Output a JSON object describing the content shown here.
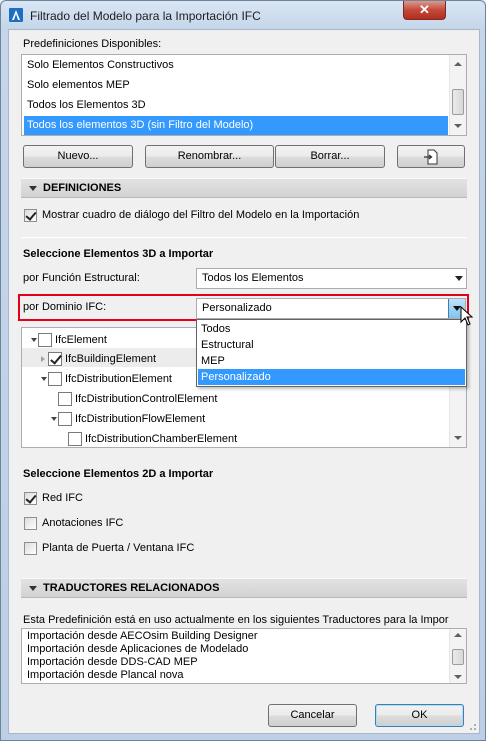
{
  "window": {
    "title": "Filtrado del Modelo para la Importación IFC",
    "close_label": "✕"
  },
  "presets": {
    "label": "Predefiniciones Disponibles:",
    "items": [
      "Solo Elementos Constructivos",
      "Solo elementos MEP",
      "Todos los Elementos 3D",
      "Todos los elementos 3D (sin Filtro del Modelo)"
    ],
    "selected_index": 3
  },
  "buttons": {
    "new": "Nuevo...",
    "rename": "Renombrar...",
    "delete": "Borrar...",
    "cancel": "Cancelar",
    "ok": "OK"
  },
  "definitions": {
    "header": "DEFINICIONES",
    "show_dialog_label": "Mostrar cuadro de diálogo del Filtro del Modelo en la Importación",
    "show_dialog_checked": true
  },
  "elements3d": {
    "heading": "Seleccione Elementos 3D a Importar",
    "structural_label": "por Función Estructural:",
    "structural_value": "Todos los Elementos",
    "domain_label": "por Dominio IFC:",
    "domain_value": "Personalizado",
    "domain_options": [
      "Todos",
      "Estructural",
      "MEP",
      "Personalizado"
    ],
    "domain_selected_index": 3
  },
  "tree": {
    "items": [
      {
        "label": "IfcElement",
        "expand": "open",
        "checked": false
      },
      {
        "label": "IfcBuildingElement",
        "expand": "closed",
        "checked": true
      },
      {
        "label": "IfcDistributionElement",
        "expand": "open",
        "checked": false
      },
      {
        "label": "IfcDistributionControlElement",
        "expand": "none",
        "checked": false
      },
      {
        "label": "IfcDistributionFlowElement",
        "expand": "open",
        "checked": false
      },
      {
        "label": "IfcDistributionChamberElement",
        "expand": "none",
        "checked": false
      }
    ]
  },
  "elements2d": {
    "heading": "Seleccione Elementos 2D a Importar",
    "items": [
      {
        "label": "Red IFC",
        "checked": true
      },
      {
        "label": "Anotaciones IFC",
        "checked": false
      },
      {
        "label": "Planta de Puerta / Ventana IFC",
        "checked": false
      }
    ]
  },
  "translators": {
    "header": "TRADUCTORES RELACIONADOS",
    "intro": "Esta Predefinición está en uso actualmente en los siguientes Traductores para la Impor",
    "items": [
      "Importación desde AECOsim Building Designer",
      "Importación desde Aplicaciones de Modelado",
      "Importación desde DDS-CAD MEP",
      "Importación desde Plancal nova"
    ]
  },
  "colors": {
    "selection": "#3399ff",
    "highlight_border": "#e3001b",
    "close_button": "#c4493a"
  }
}
